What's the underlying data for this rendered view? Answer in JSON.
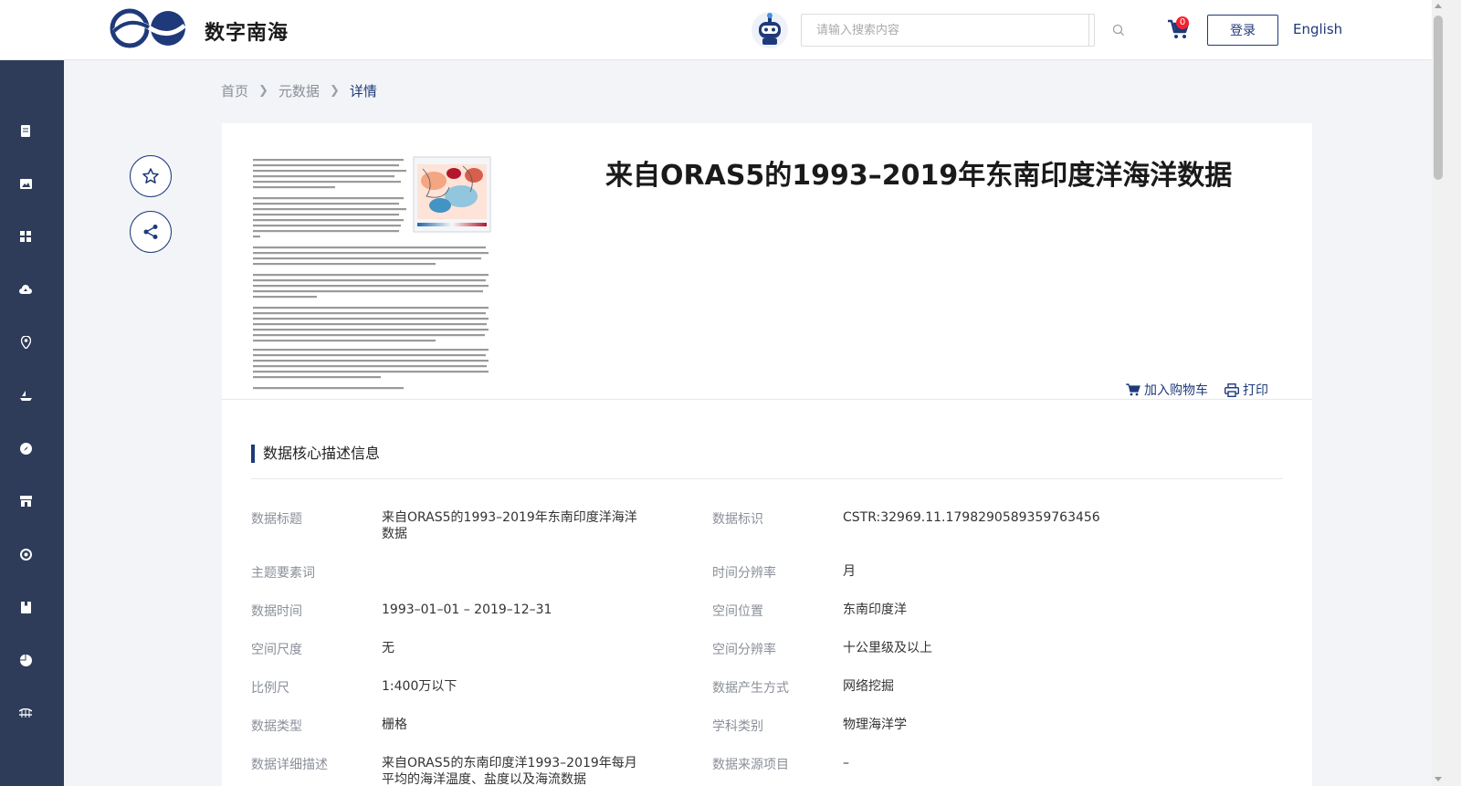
{
  "header": {
    "brand": "数字南海",
    "search_placeholder": "请输入搜索内容",
    "cart_count": "0",
    "login_label": "登录",
    "language_label": "English"
  },
  "sidebar": {
    "items": [
      "document-icon",
      "image-icon",
      "grid-icon",
      "cloud-upload-icon",
      "location-pin-icon",
      "ship-icon",
      "compass-icon",
      "storefront-icon",
      "target-icon",
      "bookmark-icon",
      "chart-pie-icon",
      "bridge-icon"
    ]
  },
  "breadcrumb": {
    "home": "首页",
    "metadata": "元数据",
    "current": "详情"
  },
  "detail": {
    "title": "来自ORAS5的1993–2019年东南印度洋海洋数据",
    "add_to_cart": "加入购物车",
    "print": "打印"
  },
  "section": {
    "title": "数据核心描述信息"
  },
  "fields": {
    "data_title_label": "数据标题",
    "data_title_value": "来自ORAS5的1993–2019年东南印度洋海洋数据",
    "data_id_label": "数据标识",
    "data_id_value": "CSTR:32969.11.1798290589359763456",
    "theme_label": "主题要素词",
    "theme_value": "",
    "time_res_label": "时间分辨率",
    "time_res_value": "月",
    "data_time_label": "数据时间",
    "data_time_value": "1993–01–01 – 2019–12–31",
    "spatial_loc_label": "空间位置",
    "spatial_loc_value": "东南印度洋",
    "spatial_scale_label": "空间尺度",
    "spatial_scale_value": "无",
    "spatial_res_label": "空间分辨率",
    "spatial_res_value": "十公里级及以上",
    "scale_label": "比例尺",
    "scale_value": "1:400万以下",
    "production_label": "数据产生方式",
    "production_value": "网络挖掘",
    "data_type_label": "数据类型",
    "data_type_value": "栅格",
    "discipline_label": "学科类别",
    "discipline_value": "物理海洋学",
    "description_label": "数据详细描述",
    "description_value": "来自ORAS5的东南印度洋1993–2019年每月平均的海洋温度、盐度以及海流数据",
    "source_project_label": "数据来源项目",
    "source_project_value": "–"
  },
  "colors": {
    "primary": "#1f3a7a",
    "sidebar": "#2e3c5a",
    "badge": "#f5222d"
  }
}
